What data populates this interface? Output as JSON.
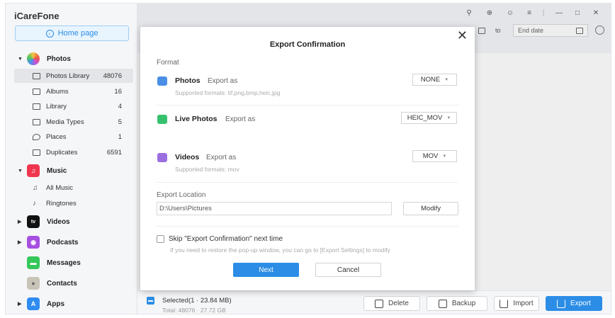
{
  "app": {
    "title": "iCareFone"
  },
  "sidebar": {
    "home_label": "Home page",
    "groups": [
      {
        "label": "Photos",
        "icon": "photos-app-icon",
        "expanded": true
      },
      {
        "label": "Music",
        "icon": "music-app-icon",
        "expanded": true
      },
      {
        "label": "Videos",
        "icon": "tv-app-icon",
        "expanded": false
      },
      {
        "label": "Podcasts",
        "icon": "podcasts-app-icon",
        "expanded": false
      },
      {
        "label": "Messages",
        "icon": "messages-app-icon"
      },
      {
        "label": "Contacts",
        "icon": "contacts-app-icon"
      },
      {
        "label": "Apps",
        "icon": "app-store-icon",
        "expanded": false
      }
    ],
    "photo_items": [
      {
        "label": "Photos Library",
        "count": "48076",
        "active": true
      },
      {
        "label": "Albums",
        "count": "16"
      },
      {
        "label": "Library",
        "count": "4"
      },
      {
        "label": "Media Types",
        "count": "5"
      },
      {
        "label": "Places",
        "count": "1"
      },
      {
        "label": "Duplicates",
        "count": "6591"
      }
    ],
    "music_items": [
      {
        "label": "All Music"
      },
      {
        "label": "Ringtones"
      }
    ]
  },
  "toolbar": {
    "to_label": "to",
    "end_date_placeholder": "End date"
  },
  "bottombar": {
    "selected_text": "Selected(1 · 23.84 MB)",
    "total_text": "Total: 48076 · 27.72 GB",
    "delete_label": "Delete",
    "backup_label": "Backup",
    "import_label": "Import",
    "export_label": "Export"
  },
  "modal": {
    "title": "Export Confirmation",
    "format_label": "Format",
    "export_as": "Export as",
    "formats": [
      {
        "name": "Photos",
        "selected": "NONE",
        "supported": "Supported formats: tif,png,bmp,heic,jpg"
      },
      {
        "name": "Live Photos",
        "selected": "HEIC_MOV",
        "supported": ""
      },
      {
        "name": "Videos",
        "selected": "MOV",
        "supported": "Supported formats: mov"
      }
    ],
    "location_label": "Export Location",
    "location_path": "D:\\Users\\Pictures",
    "modify_label": "Modify",
    "skip_label": "Skip \"Export Confirmation\" next time",
    "skip_hint": "If you need to restore the pop-up window, you can go to [Export Settings] to modify",
    "next_label": "Next",
    "cancel_label": "Cancel"
  },
  "colors": {
    "accent": "#2b8de6",
    "music_red": "#f0364f",
    "podcast_purple": "#a64fe0",
    "messages_green": "#34c759"
  }
}
